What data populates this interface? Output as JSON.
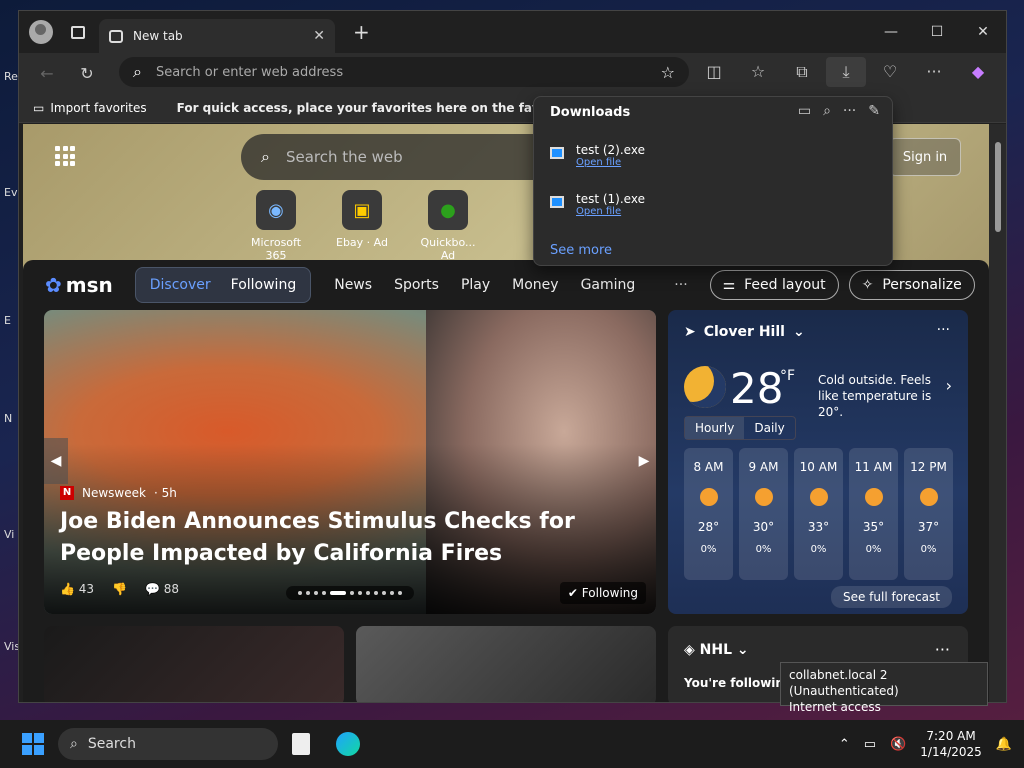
{
  "desktop": {
    "labels": [
      "Re",
      "Ev",
      "E",
      "N",
      "Vi",
      "Vis"
    ]
  },
  "browser": {
    "tab_title": "New tab",
    "omnibox_placeholder": "Search or enter web address",
    "fav_import": "Import favorites",
    "fav_hint": "For quick access, place your favorites here on the favorites bar."
  },
  "downloads": {
    "title": "Downloads",
    "items": [
      {
        "name": "test (2).exe",
        "action": "Open file"
      },
      {
        "name": "test (1).exe",
        "action": "Open file"
      }
    ],
    "see_more": "See more"
  },
  "ntp": {
    "search_placeholder": "Search the web",
    "signin": "Sign in",
    "quicklinks": [
      {
        "label": "Microsoft 365"
      },
      {
        "label": "Ebay · Ad"
      },
      {
        "label": "Quickbo... Ad"
      }
    ]
  },
  "msn": {
    "logo": "msn",
    "pill": [
      "Discover",
      "Following"
    ],
    "nav": [
      "News",
      "Sports",
      "Play",
      "Money",
      "Gaming"
    ],
    "more": "···",
    "feed_layout": "Feed layout",
    "personalize": "Personalize"
  },
  "hero": {
    "source": "Newsweek",
    "age": "· 5h",
    "headline": "Joe Biden Announces Stimulus Checks for People Impacted by California Fires",
    "likes": "43",
    "comments": "88",
    "following": "Following"
  },
  "weather": {
    "location": "Clover Hill",
    "temp": "28",
    "unit": "°F",
    "desc": "Cold outside. Feels like temperature is 20°.",
    "tabs": [
      "Hourly",
      "Daily"
    ],
    "hours": [
      {
        "time": "8 AM",
        "temp": "28°",
        "precip": "0%"
      },
      {
        "time": "9 AM",
        "temp": "30°",
        "precip": "0%"
      },
      {
        "time": "10 AM",
        "temp": "33°",
        "precip": "0%"
      },
      {
        "time": "11 AM",
        "temp": "35°",
        "precip": "0%"
      },
      {
        "time": "12 PM",
        "temp": "37°",
        "precip": "0%"
      }
    ],
    "forecast": "See full forecast"
  },
  "nhl": {
    "title": "NHL",
    "sub": "You're following th"
  },
  "tooltip": {
    "line1": "collabnet.local 2 (Unauthenticated)",
    "line2": "Internet access"
  },
  "taskbar": {
    "search": "Search",
    "time": "7:20 AM",
    "date": "1/14/2025"
  }
}
